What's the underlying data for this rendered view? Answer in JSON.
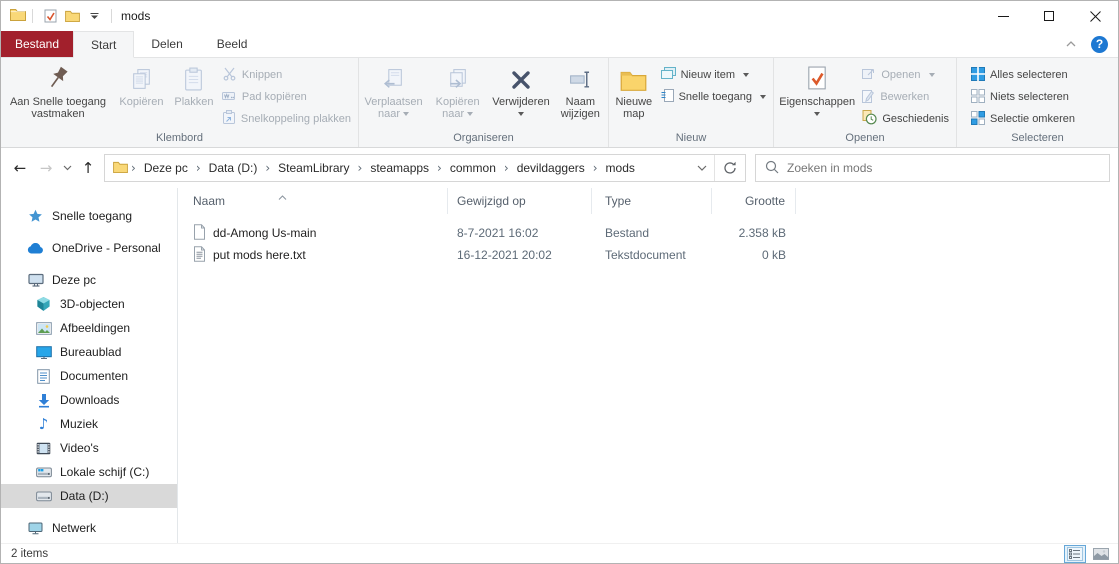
{
  "glyphs": {
    "help": "?",
    "back": "←",
    "forward": "→",
    "up": "↑",
    "crumb_sep": "›",
    "recent_chevron": "⌄",
    "music_note": "♪"
  },
  "titlebar": {
    "title": "mods"
  },
  "tabs": {
    "file": "Bestand",
    "start": "Start",
    "share": "Delen",
    "view": "Beeld"
  },
  "ribbon": {
    "clipboard": {
      "label": "Klembord",
      "pin": "Aan Snelle toegang vastmaken",
      "copy": "Kopiëren",
      "paste": "Plakken",
      "cut": "Knippen",
      "copy_path": "Pad kopiëren",
      "paste_shortcut": "Snelkoppeling plakken"
    },
    "organize": {
      "label": "Organiseren",
      "move_to": "Verplaatsen naar",
      "copy_to": "Kopiëren naar",
      "delete": "Verwijderen",
      "rename": "Naam wijzigen"
    },
    "new": {
      "label": "Nieuw",
      "new_folder": "Nieuwe map",
      "new_item": "Nieuw item",
      "quick_access": "Snelle toegang"
    },
    "open": {
      "label": "Openen",
      "properties": "Eigenschappen",
      "open": "Openen",
      "edit": "Bewerken",
      "history": "Geschiedenis"
    },
    "select": {
      "label": "Selecteren",
      "all": "Alles selecteren",
      "none": "Niets selecteren",
      "invert": "Selectie omkeren"
    }
  },
  "address": {
    "crumbs": [
      "Deze pc",
      "Data (D:)",
      "SteamLibrary",
      "steamapps",
      "common",
      "devildaggers",
      "mods"
    ]
  },
  "search": {
    "placeholder": "Zoeken in mods"
  },
  "list": {
    "columns": {
      "name": "Naam",
      "modified": "Gewijzigd op",
      "type": "Type",
      "size": "Grootte"
    },
    "files": [
      {
        "name": "dd-Among Us-main",
        "modified": "8-7-2021 16:02",
        "type": "Bestand",
        "size": "2.358 kB"
      },
      {
        "name": "put mods here.txt",
        "modified": "16-12-2021 20:02",
        "type": "Tekstdocument",
        "size": "0 kB"
      }
    ]
  },
  "sidebar": {
    "quick_access": "Snelle toegang",
    "onedrive": "OneDrive - Personal",
    "this_pc": "Deze pc",
    "pc_children": [
      "3D-objecten",
      "Afbeeldingen",
      "Bureaublad",
      "Documenten",
      "Downloads",
      "Muziek",
      "Video's",
      "Lokale schijf (C:)",
      "Data (D:)"
    ],
    "network": "Netwerk"
  },
  "statusbar": {
    "count": "2 items"
  },
  "colors": {
    "accent_red": "#A2202C",
    "selection_gray": "#d9d9d9",
    "select_blue": "#2f9ce3"
  }
}
